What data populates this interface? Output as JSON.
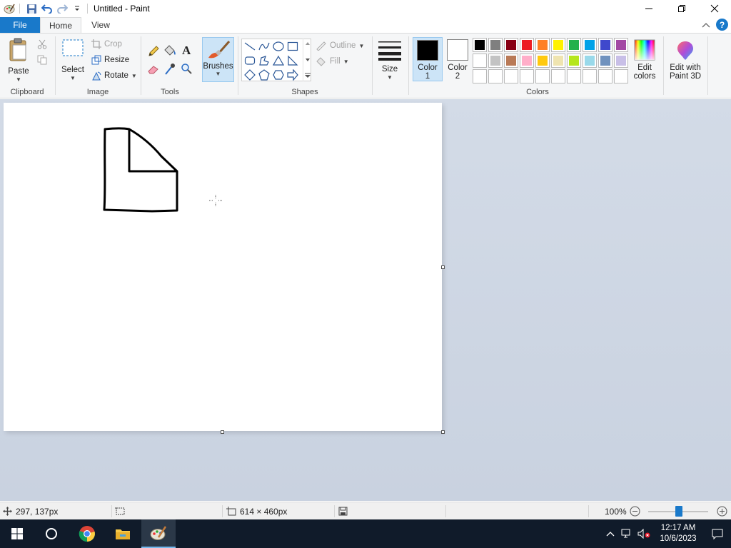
{
  "window": {
    "title": "Untitled - Paint",
    "controls": [
      "minimize-icon",
      "restore-icon",
      "close-icon"
    ]
  },
  "quick_access": [
    "save-icon",
    "undo-icon",
    "redo-icon",
    "customize-dropdown-icon"
  ],
  "tabs": {
    "file": "File",
    "home": "Home",
    "view": "View"
  },
  "ribbon": {
    "clipboard": {
      "label": "Clipboard",
      "paste": "Paste"
    },
    "image": {
      "label": "Image",
      "select": "Select",
      "crop": "Crop",
      "resize": "Resize",
      "rotate": "Rotate"
    },
    "tools": {
      "label": "Tools"
    },
    "brushes": {
      "label": "Brushes"
    },
    "shapes": {
      "label": "Shapes",
      "outline": "Outline",
      "fill": "Fill"
    },
    "size": {
      "label": "Size"
    },
    "colors": {
      "label": "Colors",
      "color1_label": "Color",
      "color1_num": "1",
      "color2_label": "Color",
      "color2_num": "2",
      "color1": "#000000",
      "color2": "#ffffff",
      "edit_colors_line1": "Edit",
      "edit_colors_line2": "colors",
      "palette_row1": [
        "#000000",
        "#7f7f7f",
        "#880015",
        "#ed1c24",
        "#ff7f27",
        "#fff200",
        "#22b14c",
        "#00a2e8",
        "#3f48cc",
        "#a349a4"
      ],
      "palette_row2": [
        "#ffffff",
        "#c3c3c3",
        "#b97a57",
        "#ffaec9",
        "#ffc90e",
        "#efe4b0",
        "#b5e61d",
        "#99d9ea",
        "#7092be",
        "#c8bfe7"
      ],
      "palette_row3": [
        "",
        "",
        "",
        "",
        "",
        "",
        "",
        "",
        "",
        ""
      ]
    },
    "paint3d": {
      "line1": "Edit with",
      "line2": "Paint 3D"
    }
  },
  "statusbar": {
    "cursor_pos": "297, 137px",
    "canvas_size": "614 × 460px",
    "zoom": "100%"
  },
  "taskbar": {
    "time": "12:17 AM",
    "date": "10/6/2023"
  },
  "colors": {
    "accent": "#1979ca",
    "ribbon_bg": "#f5f6f7",
    "workspace": "#c9d2e0",
    "taskbar": "#101b2a"
  }
}
